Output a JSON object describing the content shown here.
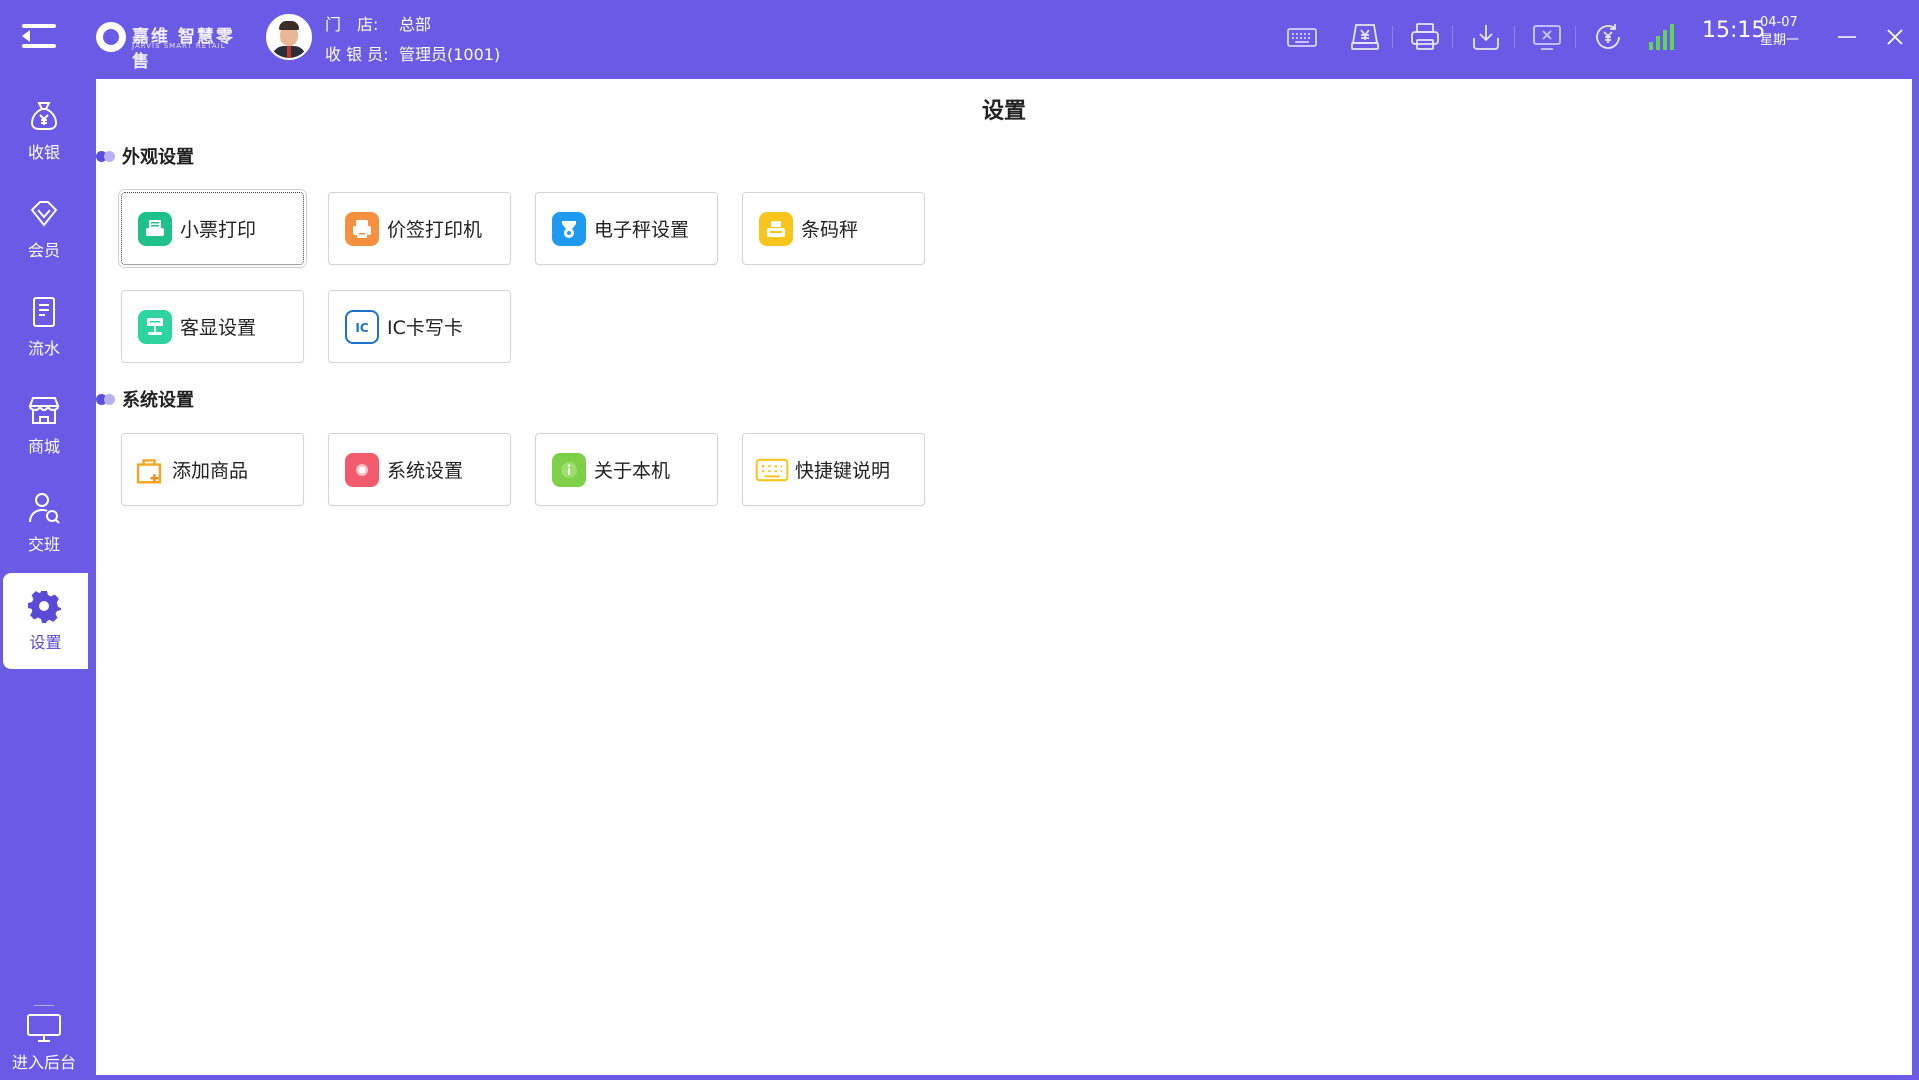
{
  "header": {
    "logo": {
      "brand": "嘉维 智慧零售",
      "tagline": "JARVIS SMART RETAIL"
    },
    "store_label": "门　店:",
    "store_value": "总部",
    "cashier_label": "收 银 员:",
    "cashier_value": "管理员(1001)",
    "time": "15:15",
    "date": "04-07",
    "weekday": "星期一"
  },
  "sidebar": {
    "items": [
      {
        "label": "收银",
        "icon": "cash-bag-icon"
      },
      {
        "label": "会员",
        "icon": "diamond-icon"
      },
      {
        "label": "流水",
        "icon": "document-icon"
      },
      {
        "label": "商城",
        "icon": "store-icon"
      },
      {
        "label": "交班",
        "icon": "user-switch-icon"
      },
      {
        "label": "设置",
        "icon": "gear-icon",
        "active": true
      }
    ],
    "backend_label": "进入后台"
  },
  "main": {
    "title": "设置",
    "sections": [
      {
        "title": "外观设置",
        "tiles": [
          {
            "label": "小票打印",
            "icon": "receipt-printer-icon",
            "color": "#1fc08a"
          },
          {
            "label": "价签打印机",
            "icon": "label-printer-icon",
            "color": "#f5913e"
          },
          {
            "label": "电子秤设置",
            "icon": "scale-icon",
            "color": "#1e9bf0"
          },
          {
            "label": "条码秤",
            "icon": "barcode-scale-icon",
            "color": "#f7c51c"
          },
          {
            "label": "客显设置",
            "icon": "customer-display-icon",
            "color": "#2dd4a0"
          },
          {
            "label": "IC卡写卡",
            "icon": "ic-card-icon",
            "color": "#1a73c8"
          }
        ]
      },
      {
        "title": "系统设置",
        "tiles": [
          {
            "label": "添加商品",
            "icon": "add-product-icon",
            "color": "#f5a623"
          },
          {
            "label": "系统设置",
            "icon": "system-settings-icon",
            "color": "#f25b6e"
          },
          {
            "label": "关于本机",
            "icon": "info-icon",
            "color": "#7ed048"
          },
          {
            "label": "快捷键说明",
            "icon": "keyboard-icon",
            "color": "#f7c51c"
          }
        ]
      }
    ]
  },
  "colors": {
    "brand": "#6a5ae6",
    "active_text": "#5a4ad6",
    "content_bg": "#ffffff"
  }
}
